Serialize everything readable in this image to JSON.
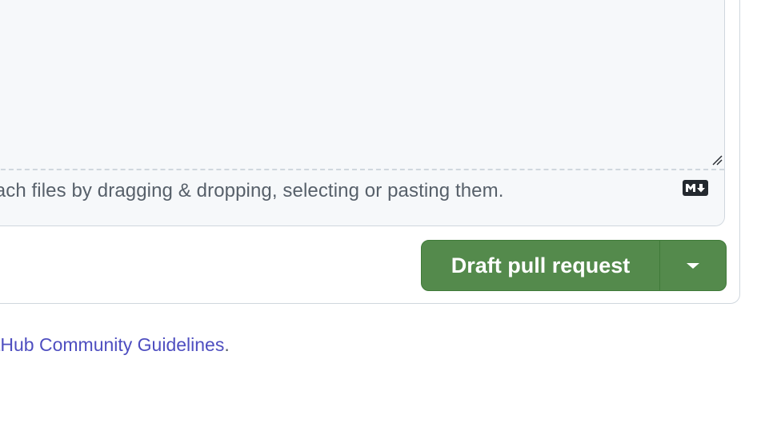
{
  "editor": {
    "attach_hint": "tach files by dragging & dropping, selecting or pasting them.",
    "markdown_badge": "markdown-icon"
  },
  "actions": {
    "primary_label": "Draft pull request",
    "dropdown_icon": "chevron-down-icon",
    "primary_color": "#548a4c"
  },
  "footer": {
    "link_text": "tHub Community Guidelines",
    "suffix": ".",
    "link_color": "#4e4ec0"
  }
}
